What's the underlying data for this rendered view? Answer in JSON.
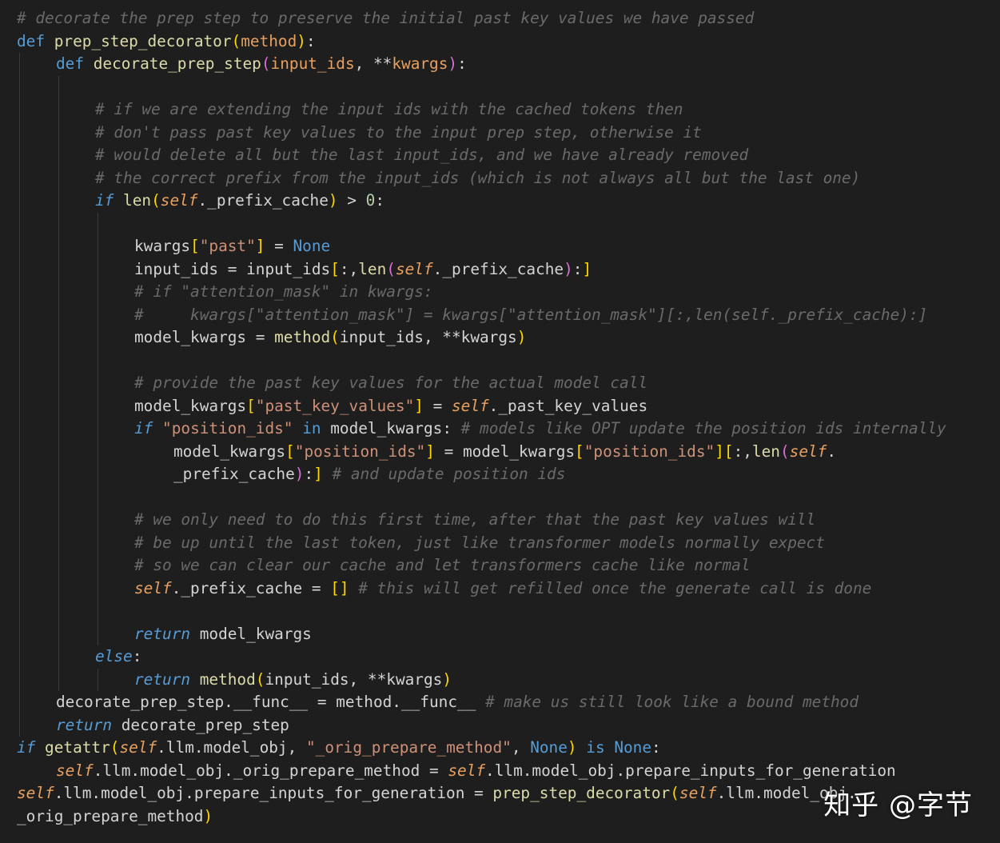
{
  "watermark": "知乎 @字节",
  "lines": [
    {
      "indent": 0,
      "tokens": [
        [
          "# decorate the prep step to preserve the initial past key values we have passed",
          "cmt"
        ]
      ]
    },
    {
      "indent": 0,
      "tokens": [
        [
          "def",
          "kw"
        ],
        [
          " ",
          "pl"
        ],
        [
          "prep_step_decorator",
          "fn"
        ],
        [
          "(",
          "br1"
        ],
        [
          "method",
          "param"
        ],
        [
          ")",
          "br1"
        ],
        [
          ":",
          "op"
        ]
      ]
    },
    {
      "indent": 1,
      "tokens": [
        [
          "def",
          "kw"
        ],
        [
          " ",
          "pl"
        ],
        [
          "decorate_prep_step",
          "fn"
        ],
        [
          "(",
          "br2"
        ],
        [
          "input_ids",
          "param"
        ],
        [
          ", ",
          "op"
        ],
        [
          "**",
          "op"
        ],
        [
          "kwargs",
          "param"
        ],
        [
          ")",
          "br2"
        ],
        [
          ":",
          "op"
        ]
      ]
    },
    {
      "indent": 0,
      "tokens": []
    },
    {
      "indent": 2,
      "tokens": [
        [
          "# if we are extending the input ids with the cached tokens then",
          "cmt"
        ]
      ]
    },
    {
      "indent": 2,
      "tokens": [
        [
          "# don't pass past key values to the input prep step, otherwise it",
          "cmt"
        ]
      ]
    },
    {
      "indent": 2,
      "tokens": [
        [
          "# would delete all but the last input_ids, and we have already removed",
          "cmt"
        ]
      ]
    },
    {
      "indent": 2,
      "tokens": [
        [
          "# the correct prefix from the input_ids (which is not always all but the last one)",
          "cmt"
        ]
      ]
    },
    {
      "indent": 2,
      "tokens": [
        [
          "if",
          "ctrl"
        ],
        [
          " ",
          "pl"
        ],
        [
          "len",
          "builtin"
        ],
        [
          "(",
          "br1"
        ],
        [
          "self",
          "selfkw"
        ],
        [
          "._prefix_cache",
          "pl"
        ],
        [
          ")",
          "br1"
        ],
        [
          " > ",
          "op"
        ],
        [
          "0",
          "num"
        ],
        [
          ":",
          "op"
        ]
      ]
    },
    {
      "indent": 0,
      "tokens": []
    },
    {
      "indent": 3,
      "tokens": [
        [
          "kwargs",
          "pl"
        ],
        [
          "[",
          "br1"
        ],
        [
          "\"past\"",
          "str"
        ],
        [
          "]",
          "br1"
        ],
        [
          " = ",
          "op"
        ],
        [
          "None",
          "const"
        ]
      ]
    },
    {
      "indent": 3,
      "tokens": [
        [
          "input_ids",
          "pl"
        ],
        [
          " = ",
          "op"
        ],
        [
          "input_ids",
          "pl"
        ],
        [
          "[",
          "br1"
        ],
        [
          ":,",
          "op"
        ],
        [
          "len",
          "builtin"
        ],
        [
          "(",
          "br2"
        ],
        [
          "self",
          "selfkw"
        ],
        [
          "._prefix_cache",
          "pl"
        ],
        [
          ")",
          "br2"
        ],
        [
          ":",
          "op"
        ],
        [
          "]",
          "br1"
        ]
      ]
    },
    {
      "indent": 3,
      "tokens": [
        [
          "# if \"attention_mask\" in kwargs:",
          "cmt"
        ]
      ]
    },
    {
      "indent": 3,
      "tokens": [
        [
          "#     kwargs[\"attention_mask\"] = kwargs[\"attention_mask\"][:,len(self._prefix_cache):]",
          "cmt"
        ]
      ]
    },
    {
      "indent": 3,
      "tokens": [
        [
          "model_kwargs",
          "pl"
        ],
        [
          " = ",
          "op"
        ],
        [
          "method",
          "fn"
        ],
        [
          "(",
          "br1"
        ],
        [
          "input_ids",
          "pl"
        ],
        [
          ", ",
          "op"
        ],
        [
          "**",
          "op"
        ],
        [
          "kwargs",
          "pl"
        ],
        [
          ")",
          "br1"
        ]
      ]
    },
    {
      "indent": 0,
      "tokens": []
    },
    {
      "indent": 3,
      "tokens": [
        [
          "# provide the past key values for the actual model call",
          "cmt"
        ]
      ]
    },
    {
      "indent": 3,
      "tokens": [
        [
          "model_kwargs",
          "pl"
        ],
        [
          "[",
          "br1"
        ],
        [
          "\"past_key_values\"",
          "str"
        ],
        [
          "]",
          "br1"
        ],
        [
          " = ",
          "op"
        ],
        [
          "self",
          "selfkw"
        ],
        [
          "._past_key_values",
          "pl"
        ]
      ]
    },
    {
      "indent": 3,
      "tokens": [
        [
          "if",
          "ctrl"
        ],
        [
          " ",
          "pl"
        ],
        [
          "\"position_ids\"",
          "str"
        ],
        [
          " ",
          "pl"
        ],
        [
          "in",
          "kw"
        ],
        [
          " model_kwargs",
          "pl"
        ],
        [
          ": ",
          "op"
        ],
        [
          "# models like OPT update the position ids internally",
          "cmt"
        ]
      ]
    },
    {
      "indent": 4,
      "tokens": [
        [
          "model_kwargs",
          "pl"
        ],
        [
          "[",
          "br1"
        ],
        [
          "\"position_ids\"",
          "str"
        ],
        [
          "]",
          "br1"
        ],
        [
          " = ",
          "op"
        ],
        [
          "model_kwargs",
          "pl"
        ],
        [
          "[",
          "br1"
        ],
        [
          "\"position_ids\"",
          "str"
        ],
        [
          "]",
          "br1"
        ],
        [
          "[",
          "br1"
        ],
        [
          ":,",
          "op"
        ],
        [
          "len",
          "builtin"
        ],
        [
          "(",
          "br2"
        ],
        [
          "self",
          "selfkw"
        ],
        [
          ".",
          "pl"
        ]
      ]
    },
    {
      "indent": 4,
      "tokens": [
        [
          "_prefix_cache",
          "pl"
        ],
        [
          ")",
          "br2"
        ],
        [
          ":",
          "op"
        ],
        [
          "]",
          "br1"
        ],
        [
          " ",
          "pl"
        ],
        [
          "# and update position ids",
          "cmt"
        ]
      ]
    },
    {
      "indent": 0,
      "tokens": []
    },
    {
      "indent": 3,
      "tokens": [
        [
          "# we only need to do this first time, after that the past key values will",
          "cmt"
        ]
      ]
    },
    {
      "indent": 3,
      "tokens": [
        [
          "# be up until the last token, just like transformer models normally expect",
          "cmt"
        ]
      ]
    },
    {
      "indent": 3,
      "tokens": [
        [
          "# so we can clear our cache and let transformers cache like normal",
          "cmt"
        ]
      ]
    },
    {
      "indent": 3,
      "tokens": [
        [
          "self",
          "selfkw"
        ],
        [
          "._prefix_cache",
          "pl"
        ],
        [
          " = ",
          "op"
        ],
        [
          "[]",
          "br1"
        ],
        [
          " ",
          "pl"
        ],
        [
          "# this will get refilled once the generate call is done",
          "cmt"
        ]
      ]
    },
    {
      "indent": 0,
      "tokens": []
    },
    {
      "indent": 3,
      "tokens": [
        [
          "return",
          "ctrl"
        ],
        [
          " model_kwargs",
          "pl"
        ]
      ]
    },
    {
      "indent": 2,
      "tokens": [
        [
          "else",
          "ctrl"
        ],
        [
          ":",
          "op"
        ]
      ]
    },
    {
      "indent": 3,
      "tokens": [
        [
          "return",
          "ctrl"
        ],
        [
          " ",
          "pl"
        ],
        [
          "method",
          "fn"
        ],
        [
          "(",
          "br1"
        ],
        [
          "input_ids",
          "pl"
        ],
        [
          ", ",
          "op"
        ],
        [
          "**",
          "op"
        ],
        [
          "kwargs",
          "pl"
        ],
        [
          ")",
          "br1"
        ]
      ]
    },
    {
      "indent": 1,
      "tokens": [
        [
          "decorate_prep_step",
          "pl"
        ],
        [
          ".__func__",
          "pl"
        ],
        [
          " = ",
          "op"
        ],
        [
          "method",
          "pl"
        ],
        [
          ".__func__",
          "pl"
        ],
        [
          " ",
          "pl"
        ],
        [
          "# make us still look like a bound method",
          "cmt"
        ]
      ]
    },
    {
      "indent": 1,
      "tokens": [
        [
          "return",
          "ctrl"
        ],
        [
          " decorate_prep_step",
          "pl"
        ]
      ]
    },
    {
      "indent": 0,
      "tokens": [
        [
          "if",
          "ctrl"
        ],
        [
          " ",
          "pl"
        ],
        [
          "getattr",
          "builtin"
        ],
        [
          "(",
          "br1"
        ],
        [
          "self",
          "selfkw"
        ],
        [
          ".llm.model_obj",
          "pl"
        ],
        [
          ", ",
          "op"
        ],
        [
          "\"_orig_prepare_method\"",
          "str"
        ],
        [
          ", ",
          "op"
        ],
        [
          "None",
          "const"
        ],
        [
          ")",
          "br1"
        ],
        [
          " ",
          "pl"
        ],
        [
          "is",
          "kw"
        ],
        [
          " ",
          "pl"
        ],
        [
          "None",
          "const"
        ],
        [
          ":",
          "op"
        ]
      ]
    },
    {
      "indent": 1,
      "tokens": [
        [
          "self",
          "selfkw"
        ],
        [
          ".llm.model_obj._orig_prepare_method",
          "pl"
        ],
        [
          " = ",
          "op"
        ],
        [
          "self",
          "selfkw"
        ],
        [
          ".llm.model_obj.prepare_inputs_for_generation",
          "pl"
        ]
      ]
    },
    {
      "indent": 0,
      "tokens": [
        [
          "self",
          "selfkw"
        ],
        [
          ".llm.model_obj.prepare_inputs_for_generation",
          "pl"
        ],
        [
          " = ",
          "op"
        ],
        [
          "prep_step_decorator",
          "fn"
        ],
        [
          "(",
          "br1"
        ],
        [
          "self",
          "selfkw"
        ],
        [
          ".llm.model_obj.",
          "pl"
        ]
      ]
    },
    {
      "indent": 0,
      "tokens": [
        [
          "_orig_prepare_method",
          "pl"
        ],
        [
          ")",
          "br1"
        ]
      ]
    }
  ]
}
